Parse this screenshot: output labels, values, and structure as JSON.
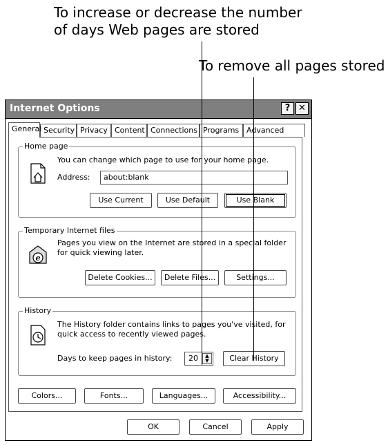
{
  "callouts": {
    "days_line1": "To increase or decrease the number",
    "days_line2": "of days Web pages are stored",
    "remove_all": "To remove all pages stored"
  },
  "window": {
    "title": "Internet Options",
    "help_glyph": "?",
    "close_glyph": "✕"
  },
  "tabs": [
    "General",
    "Security",
    "Privacy",
    "Content",
    "Connections",
    "Programs",
    "Advanced"
  ],
  "home_page": {
    "group_label": "Home page",
    "description": "You can change which page to use for your home page.",
    "address_label": "Address:",
    "address_value": "about:blank",
    "use_current": "Use Current",
    "use_default": "Use Default",
    "use_blank": "Use Blank"
  },
  "temp_files": {
    "group_label": "Temporary Internet files",
    "description_line1": "Pages you view on the Internet are stored in a special folder",
    "description_line2": "for quick viewing later.",
    "delete_cookies": "Delete Cookies...",
    "delete_files": "Delete Files...",
    "settings": "Settings..."
  },
  "history": {
    "group_label": "History",
    "description_line1": "The History folder contains links to pages you've visited, for",
    "description_line2": "quick access to recently viewed pages.",
    "days_label": "Days to keep pages in history:",
    "days_value": "20",
    "clear_history": "Clear History"
  },
  "bottom_buttons": {
    "colors": "Colors...",
    "fonts": "Fonts...",
    "languages": "Languages...",
    "accessibility": "Accessibility..."
  },
  "dialog_buttons": {
    "ok": "OK",
    "cancel": "Cancel",
    "apply": "Apply"
  }
}
